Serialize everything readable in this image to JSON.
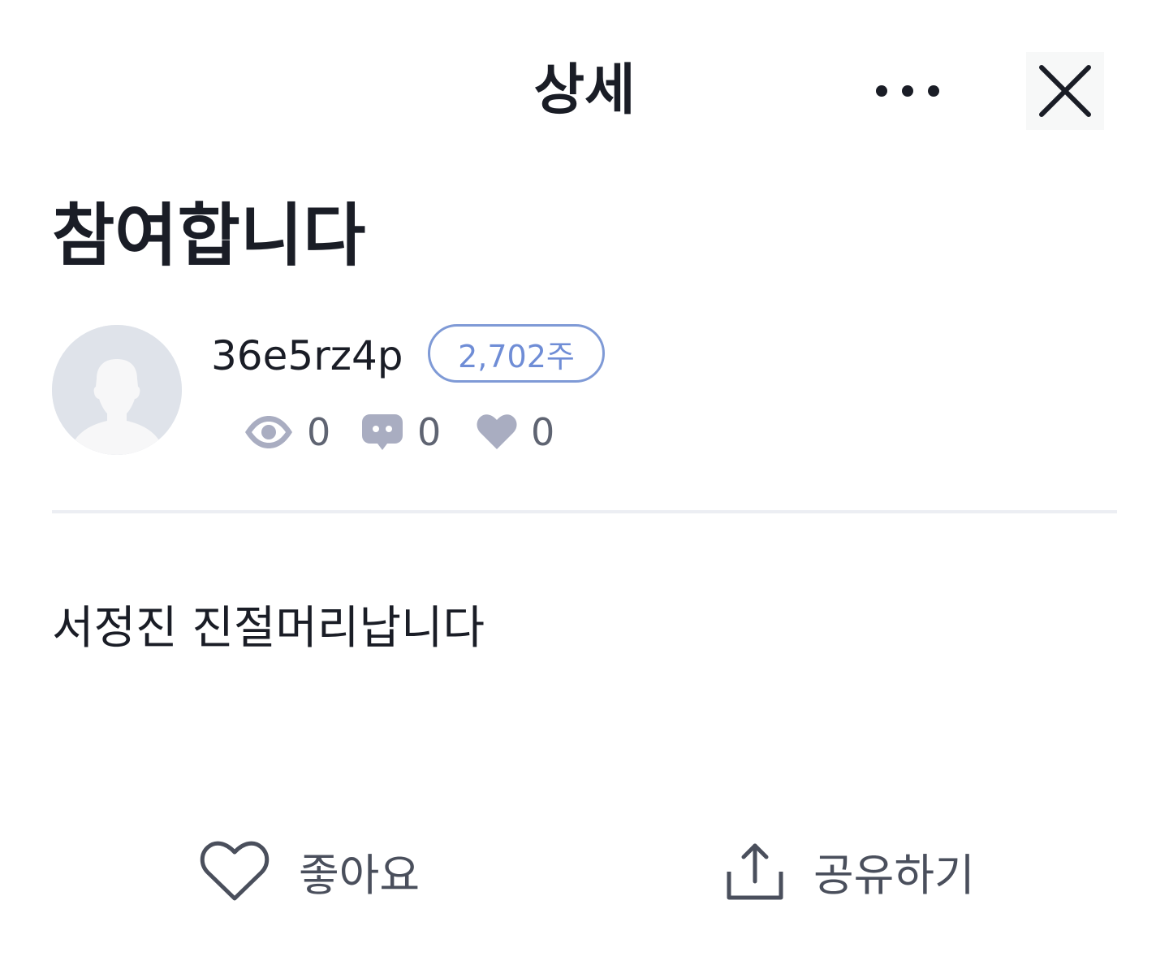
{
  "header": {
    "title": "상세",
    "more_icon": "more-horizontal-icon",
    "close_icon": "close-icon"
  },
  "post": {
    "title": "참여합니다",
    "author": {
      "name": "36e5rz4p",
      "points_badge": "2,702주",
      "avatar_icon": "default-avatar-icon"
    },
    "stats": {
      "views": "0",
      "comments": "0",
      "likes": "0"
    },
    "body": "서정진 진절머리납니다"
  },
  "actions": {
    "like_label": "좋아요",
    "share_label": "공유하기"
  },
  "colors": {
    "text_primary": "#1a1d26",
    "badge_accent": "#6f8dd6",
    "stat_icon": "#a9adc1",
    "action_icon": "#4a4f5c",
    "divider": "#eceef3"
  }
}
